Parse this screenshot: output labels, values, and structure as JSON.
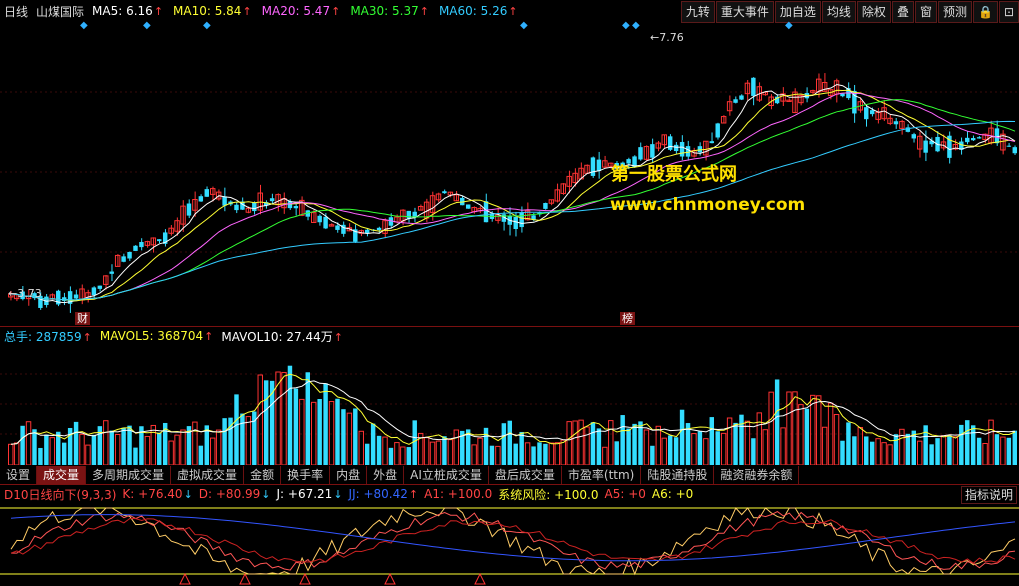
{
  "top": {
    "period": "日线",
    "stock_name": "山煤国际",
    "ma": [
      {
        "label": "MA5: 6.16",
        "color": "#ffffff"
      },
      {
        "label": "MA10: 5.84",
        "color": "#ffff33"
      },
      {
        "label": "MA20: 5.47",
        "color": "#ff66ff"
      },
      {
        "label": "MA30: 5.37",
        "color": "#33ff33"
      },
      {
        "label": "MA60: 5.26",
        "color": "#33ccff"
      }
    ],
    "buttons": [
      "九转",
      "重大事件",
      "加自选",
      "均线",
      "除权",
      "叠",
      "窗",
      "预测"
    ],
    "lock_icon": "lock-icon",
    "expand_icon": "expand-icon"
  },
  "price_chart": {
    "high_label": "7.76",
    "low_label": "3.73",
    "badge_cai": "财",
    "badge_bang": "榜",
    "watermark_cn": "第一股票公式网",
    "watermark_url": "www.chnmoney.com"
  },
  "volume_panel": {
    "total": "总手: 287859",
    "mavol5": "MAVOL5: 368704",
    "mavol10": "MAVOL10: 27.44万",
    "colors": {
      "total": "#33ccff",
      "mavol5": "#ffff33",
      "mavol10": "#ffffff"
    }
  },
  "tabs": [
    "设置",
    "成交量",
    "多周期成交量",
    "虚拟成交量",
    "金额",
    "换手率",
    "内盘",
    "外盘",
    "AI立桩成交量",
    "盘后成交量",
    "市盈率(ttm)",
    "陆股通持股",
    "融资融券余额"
  ],
  "active_tab_index": 1,
  "kdj_panel": {
    "title": "D10日线向下(9,3,3)",
    "items": [
      {
        "label": "K: +76.40",
        "color": "#ff4444",
        "arrow": "↓",
        "arrow_color": "#33ccff"
      },
      {
        "label": "D: +80.99",
        "color": "#ff4444",
        "arrow": "↓",
        "arrow_color": "#33ccff"
      },
      {
        "label": "J: +67.21",
        "color": "#ffffff",
        "arrow": "↓",
        "arrow_color": "#33ccff"
      },
      {
        "label": "JJ: +80.42",
        "color": "#3366ff",
        "arrow": "↑",
        "arrow_color": "#ff4444"
      },
      {
        "label": "A1: +100.0",
        "color": "#ff4444",
        "arrow": "",
        "arrow_color": ""
      },
      {
        "label": "系统风险: +100.0",
        "color": "#ffff33",
        "arrow": "",
        "arrow_color": ""
      },
      {
        "label": "A5: +0",
        "color": "#ff4444",
        "arrow": "",
        "arrow_color": ""
      },
      {
        "label": "A6: +0",
        "color": "#ffff33",
        "arrow": "",
        "arrow_color": ""
      }
    ],
    "help_button": "指标说明"
  },
  "chart_data": {
    "type": "candlestick",
    "ohlc_approx": [
      [
        3.73,
        3.85,
        3.7,
        3.78
      ],
      [
        3.78,
        3.82,
        3.7,
        3.76
      ],
      [
        3.76,
        3.8,
        3.72,
        3.74
      ],
      [
        3.74,
        3.8,
        3.72,
        3.77
      ],
      [
        3.77,
        3.9,
        3.75,
        3.88
      ],
      [
        3.88,
        4.4,
        3.85,
        4.35
      ],
      [
        4.35,
        4.7,
        4.3,
        4.6
      ],
      [
        4.6,
        4.8,
        4.5,
        4.72
      ],
      [
        4.72,
        5.2,
        4.7,
        5.1
      ],
      [
        5.1,
        5.6,
        5.0,
        5.5
      ],
      [
        5.5,
        5.65,
        5.2,
        5.3
      ],
      [
        5.3,
        5.45,
        5.1,
        5.2
      ],
      [
        5.2,
        5.4,
        5.05,
        5.35
      ],
      [
        5.35,
        5.5,
        5.2,
        5.25
      ],
      [
        5.25,
        5.35,
        5.0,
        5.05
      ],
      [
        5.05,
        5.15,
        4.85,
        4.9
      ],
      [
        4.9,
        5.0,
        4.7,
        4.8
      ],
      [
        4.8,
        4.95,
        4.7,
        4.9
      ],
      [
        4.9,
        5.1,
        4.85,
        5.05
      ],
      [
        5.05,
        5.3,
        5.0,
        5.25
      ],
      [
        5.25,
        5.6,
        5.2,
        5.5
      ],
      [
        5.5,
        5.6,
        5.2,
        5.25
      ],
      [
        5.25,
        5.35,
        5.05,
        5.1
      ],
      [
        5.1,
        5.2,
        4.95,
        5.0
      ],
      [
        5.0,
        5.1,
        4.9,
        5.05
      ],
      [
        5.05,
        5.5,
        5.0,
        5.4
      ],
      [
        5.4,
        5.8,
        5.35,
        5.75
      ],
      [
        5.75,
        6.1,
        5.7,
        6.0
      ],
      [
        6.0,
        6.2,
        5.85,
        5.9
      ],
      [
        5.9,
        6.1,
        5.8,
        6.05
      ],
      [
        6.05,
        6.4,
        6.0,
        6.3
      ],
      [
        6.3,
        6.45,
        6.0,
        6.1
      ],
      [
        6.1,
        6.3,
        5.9,
        6.2
      ],
      [
        6.2,
        7.0,
        6.15,
        6.9
      ],
      [
        6.9,
        7.76,
        6.8,
        7.2
      ],
      [
        7.2,
        7.4,
        6.9,
        7.0
      ],
      [
        7.0,
        7.2,
        6.8,
        6.95
      ],
      [
        6.95,
        7.3,
        6.9,
        7.2
      ],
      [
        7.2,
        7.35,
        7.0,
        7.1
      ],
      [
        7.1,
        7.2,
        6.85,
        6.9
      ],
      [
        6.9,
        7.0,
        6.6,
        6.7
      ],
      [
        6.7,
        6.8,
        6.4,
        6.5
      ],
      [
        6.5,
        6.6,
        6.2,
        6.3
      ],
      [
        6.3,
        6.4,
        6.1,
        6.2
      ],
      [
        6.2,
        6.4,
        6.1,
        6.35
      ],
      [
        6.35,
        6.6,
        6.3,
        6.4
      ],
      [
        6.4,
        6.45,
        6.1,
        6.16
      ]
    ]
  }
}
